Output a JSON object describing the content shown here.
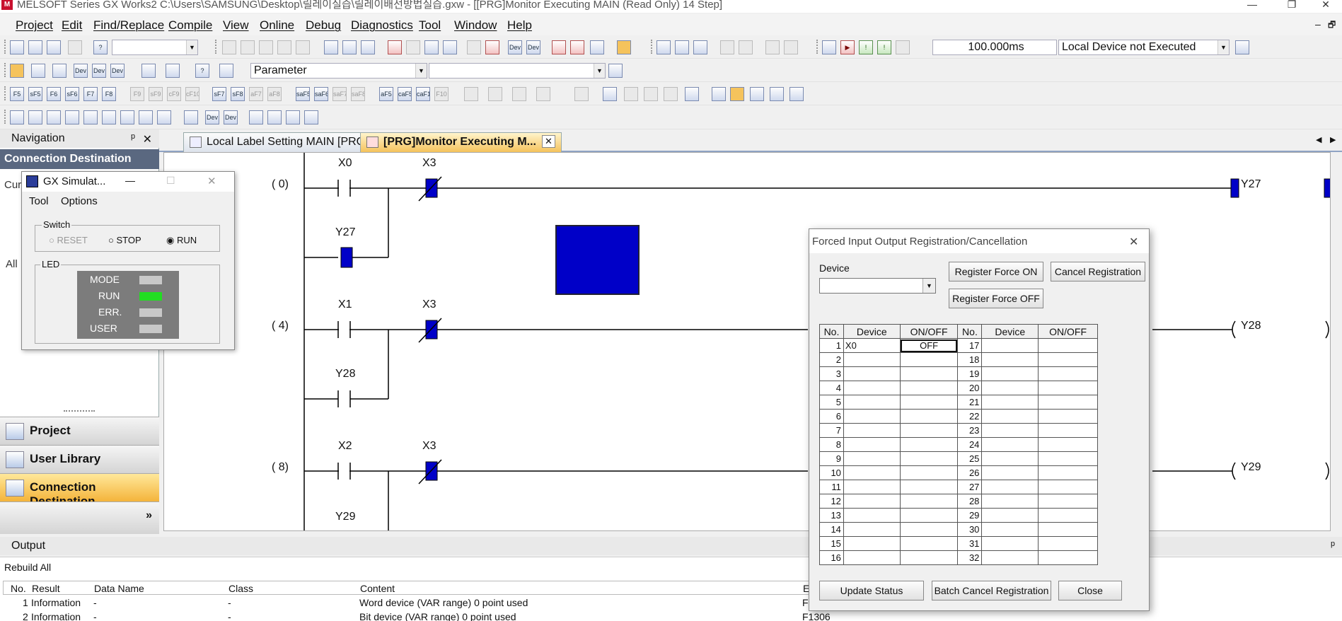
{
  "window": {
    "title": "MELSOFT Series GX Works2 C:\\Users\\SAMSUNG\\Desktop\\릴레이실습\\릴레이배선방법실습.gxw - [[PRG]Monitor Executing MAIN (Read Only) 14 Step]",
    "app_icon": "melsoft-icon",
    "minimize": "—",
    "restore": "❐",
    "close": "✕",
    "doc_min": "–",
    "doc_restore": "🗗"
  },
  "menu": [
    "Project",
    "Edit",
    "Find/Replace",
    "Compile",
    "View",
    "Online",
    "Debug",
    "Diagnostics",
    "Tool",
    "Window",
    "Help"
  ],
  "toolbar": {
    "scan_time": "100.000ms",
    "execution_status": "Local Device not Executed",
    "parameter_combo": "Parameter",
    "row3_keys": [
      "F5",
      "sF5",
      "F6",
      "sF6",
      "F7",
      "F8",
      "F9",
      "sF9",
      "cF9",
      "cF10",
      "sF7",
      "sF8",
      "aF7",
      "aF8",
      "saF5",
      "saF6",
      "saF7",
      "saF8",
      "aF5",
      "caF5",
      "caF10",
      "F10"
    ]
  },
  "navigation": {
    "title": "Navigation",
    "pin": "ᵖ",
    "close": "✕",
    "section": "Connection Destination",
    "partial_label_1": "Cur",
    "partial_label_2": "All",
    "buttons": [
      {
        "label": "Project",
        "icon": "project-icon"
      },
      {
        "label": "User Library",
        "icon": "library-icon"
      },
      {
        "label": "Connection Destination",
        "icon": "connection-icon"
      }
    ],
    "expand": "»"
  },
  "tabs": [
    {
      "label": "Local Label Setting MAIN [PRG]",
      "active": false
    },
    {
      "label": "[PRG]Monitor Executing M...",
      "active": true
    }
  ],
  "tab_close": "✕",
  "tab_scroll_left": "◀",
  "tab_scroll_right": "▶",
  "ladder": {
    "rungs": [
      {
        "step": "(   0)",
        "contacts": [
          "X0",
          "X3"
        ],
        "branch": "Y27",
        "coil": "Y27"
      },
      {
        "step": "(   4)",
        "contacts": [
          "X1",
          "X3"
        ],
        "branch": "Y28",
        "coil": "Y28"
      },
      {
        "step": "(   8)",
        "contacts": [
          "X2",
          "X3"
        ],
        "branch": "Y29",
        "coil": "Y29"
      }
    ]
  },
  "simulator": {
    "title": "GX Simulat...",
    "min": "—",
    "max": "☐",
    "close": "✕",
    "menu": [
      "Tool",
      "Options"
    ],
    "switch_label": "Switch",
    "switch_options": [
      "RESET",
      "STOP",
      "RUN"
    ],
    "switch_selected": "RUN",
    "led_label": "LED",
    "leds": [
      {
        "name": "MODE",
        "on": false
      },
      {
        "name": "RUN",
        "on": true
      },
      {
        "name": "ERR.",
        "on": false
      },
      {
        "name": "USER",
        "on": false
      }
    ],
    "led_on_color": "#22dd22",
    "led_off_color": "#c8c8c8"
  },
  "dialog": {
    "title": "Forced Input Output Registration/Cancellation",
    "close": "✕",
    "device_label": "Device",
    "device_value": "",
    "btn_force_on": "Register Force ON",
    "btn_cancel_reg": "Cancel Registration",
    "btn_force_off": "Register Force OFF",
    "headers": [
      "No.",
      "Device",
      "ON/OFF",
      "No.",
      "Device",
      "ON/OFF"
    ],
    "rows_left": [
      {
        "no": "1",
        "device": "X0",
        "state": "OFF"
      },
      {
        "no": "2",
        "device": "",
        "state": ""
      },
      {
        "no": "3",
        "device": "",
        "state": ""
      },
      {
        "no": "4",
        "device": "",
        "state": ""
      },
      {
        "no": "5",
        "device": "",
        "state": ""
      },
      {
        "no": "6",
        "device": "",
        "state": ""
      },
      {
        "no": "7",
        "device": "",
        "state": ""
      },
      {
        "no": "8",
        "device": "",
        "state": ""
      },
      {
        "no": "9",
        "device": "",
        "state": ""
      },
      {
        "no": "10",
        "device": "",
        "state": ""
      },
      {
        "no": "11",
        "device": "",
        "state": ""
      },
      {
        "no": "12",
        "device": "",
        "state": ""
      },
      {
        "no": "13",
        "device": "",
        "state": ""
      },
      {
        "no": "14",
        "device": "",
        "state": ""
      },
      {
        "no": "15",
        "device": "",
        "state": ""
      },
      {
        "no": "16",
        "device": "",
        "state": ""
      }
    ],
    "rows_right": [
      "17",
      "18",
      "19",
      "20",
      "21",
      "22",
      "23",
      "24",
      "25",
      "26",
      "27",
      "28",
      "29",
      "30",
      "31",
      "32"
    ],
    "btn_update": "Update Status",
    "btn_batch_cancel": "Batch Cancel Registration",
    "btn_close": "Close"
  },
  "output": {
    "title": "Output",
    "pin": "ᵖ",
    "subtitle": "Rebuild All",
    "columns": [
      "No.",
      "Result",
      "Data Name",
      "Class",
      "Content",
      "Er"
    ],
    "rows": [
      {
        "no": "1",
        "result": "Information",
        "data_name": "-",
        "class": "-",
        "content": "Word device (VAR range) 0 point used",
        "code": "F"
      },
      {
        "no": "2",
        "result": "Information",
        "data_name": "-",
        "class": "-",
        "content": "Bit device (VAR range) 0 point used",
        "code": "F1306"
      }
    ]
  },
  "colors": {
    "accent_blue": "#0000c8",
    "active_tab": "#f5c35c",
    "nav_header": "#5a6880"
  }
}
